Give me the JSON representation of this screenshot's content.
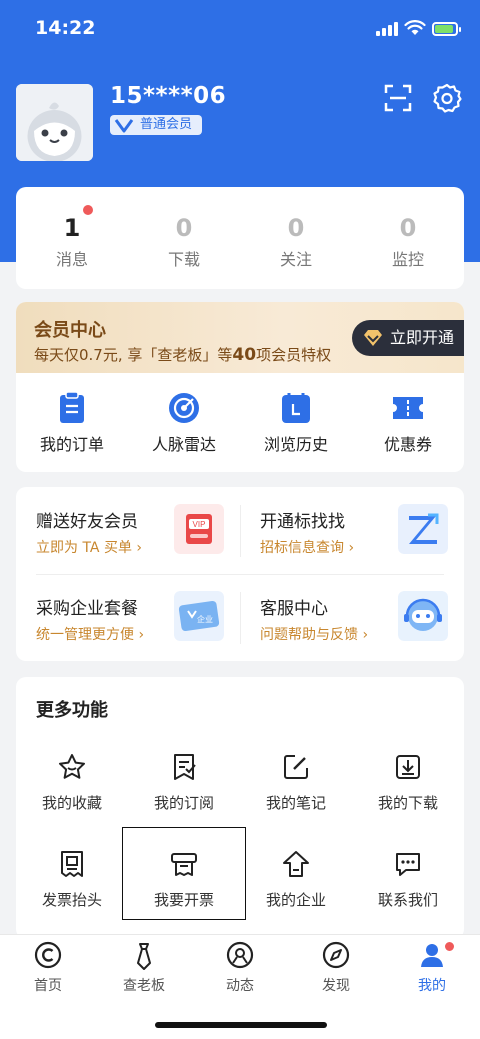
{
  "status_bar": {
    "time": "14:22"
  },
  "profile": {
    "username": "15****06",
    "member_level": "普通会员"
  },
  "stats": [
    {
      "label": "消息",
      "count": "1",
      "has_dot": true
    },
    {
      "label": "下载",
      "count": "0"
    },
    {
      "label": "关注",
      "count": "0"
    },
    {
      "label": "监控",
      "count": "0"
    }
  ],
  "vip_banner": {
    "title": "会员中心",
    "subtitle_prefix": "每天仅0.7元, 享「查老板」等",
    "subtitle_count": "40",
    "subtitle_suffix": "项会员特权",
    "button_label": "立即开通"
  },
  "orders": [
    {
      "label": "我的订单",
      "icon": "clipboard-icon"
    },
    {
      "label": "人脉雷达",
      "icon": "radar-icon"
    },
    {
      "label": "浏览历史",
      "icon": "history-icon"
    },
    {
      "label": "优惠券",
      "icon": "coupon-icon"
    }
  ],
  "services": [
    {
      "title": "赠送好友会员",
      "subtitle": "立即为 TA 买单 ›",
      "icon": "vip-card-icon"
    },
    {
      "title": "开通标找找",
      "subtitle": "招标信息查询 ›",
      "icon": "z-logo-icon"
    },
    {
      "title": "采购企业套餐",
      "subtitle": "统一管理更方便 ›",
      "icon": "enterprise-card-icon",
      "badge": "企业"
    },
    {
      "title": "客服中心",
      "subtitle": "问题帮助与反馈 ›",
      "icon": "robot-icon"
    }
  ],
  "more": {
    "title": "更多功能",
    "items": [
      {
        "label": "我的收藏",
        "icon": "star-icon"
      },
      {
        "label": "我的订阅",
        "icon": "subscribe-icon"
      },
      {
        "label": "我的笔记",
        "icon": "note-icon"
      },
      {
        "label": "我的下载",
        "icon": "download-icon"
      },
      {
        "label": "发票抬头",
        "icon": "invoice-header-icon"
      },
      {
        "label": "我要开票",
        "icon": "invoice-icon"
      },
      {
        "label": "我的企业",
        "icon": "company-icon"
      },
      {
        "label": "联系我们",
        "icon": "chat-icon"
      }
    ]
  },
  "tabbar": [
    {
      "label": "首页",
      "icon": "home-c-icon"
    },
    {
      "label": "查老板",
      "icon": "tie-icon"
    },
    {
      "label": "动态",
      "icon": "dynamic-icon"
    },
    {
      "label": "发现",
      "icon": "compass-icon"
    },
    {
      "label": "我的",
      "icon": "user-icon",
      "active": true
    }
  ],
  "colors": {
    "primary": "#2e6fe6",
    "vip_text": "#7a4a18",
    "service_sub": "#c8872f",
    "dot": "#ef5a5a"
  }
}
